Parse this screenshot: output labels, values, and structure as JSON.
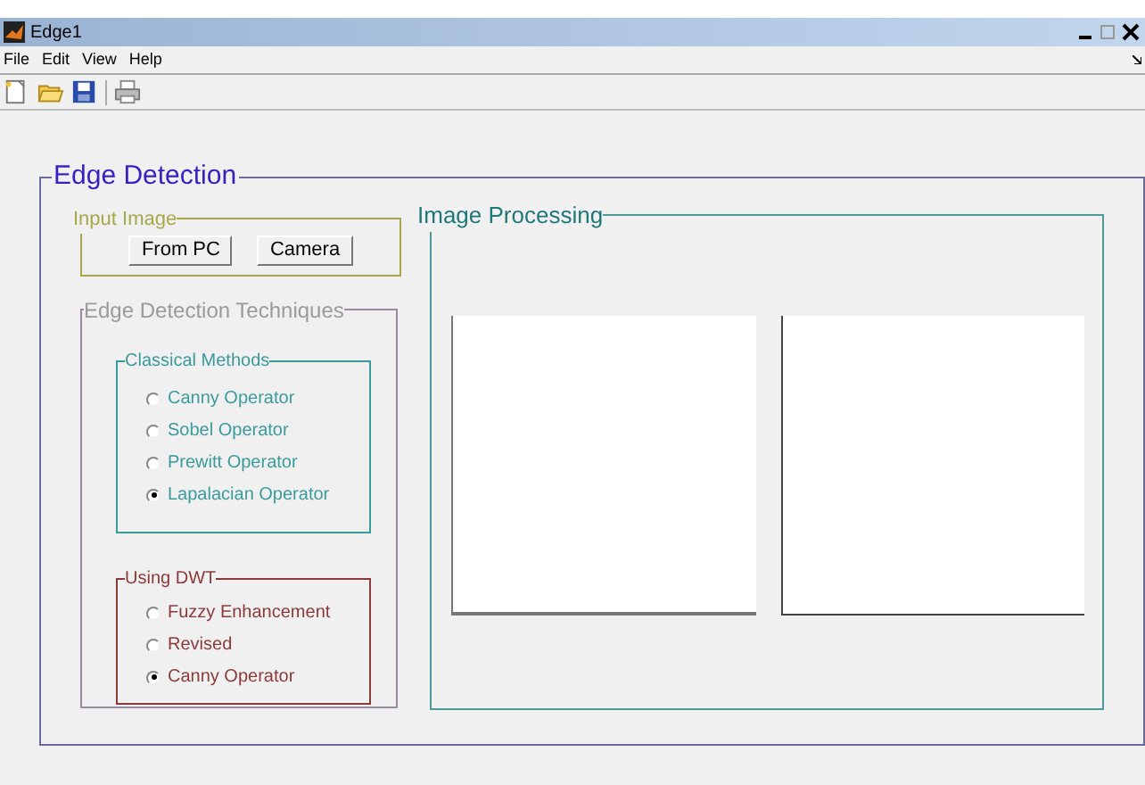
{
  "window": {
    "title": "Edge1"
  },
  "menu": [
    "File",
    "Edit",
    "View",
    "Help"
  ],
  "toolbar": [
    {
      "kind": "new"
    },
    {
      "kind": "open"
    },
    {
      "kind": "save"
    },
    {
      "kind": "print"
    }
  ],
  "main_panel": {
    "title": "Edge Detection"
  },
  "input_image": {
    "title": "Input Image",
    "buttons": [
      "From PC",
      "Camera"
    ]
  },
  "techniques": {
    "title": "Edge Detection Techniques",
    "groups": [
      {
        "title": "Classical Methods",
        "color": "#3b9a9a",
        "options": [
          {
            "label": "Canny Operator",
            "selected": false
          },
          {
            "label": "Sobel Operator",
            "selected": false
          },
          {
            "label": "Prewitt Operator",
            "selected": false
          },
          {
            "label": "Lapalacian Operator",
            "selected": true
          }
        ]
      },
      {
        "title": "Using DWT",
        "color": "#8a3a3a",
        "options": [
          {
            "label": "Fuzzy Enhancement",
            "selected": false
          },
          {
            "label": "Revised",
            "selected": false
          },
          {
            "label": "Canny Operator",
            "selected": true
          }
        ]
      }
    ]
  },
  "image_processing": {
    "title": "Image Processing"
  }
}
